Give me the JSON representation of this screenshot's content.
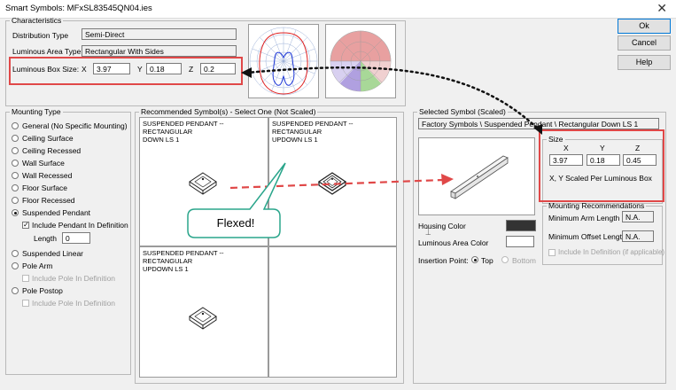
{
  "window": {
    "title": "Smart Symbols: MFxSL83545QN04.ies",
    "close_glyph": "✕"
  },
  "buttons": {
    "ok": "Ok",
    "cancel": "Cancel",
    "help": "Help"
  },
  "characteristics": {
    "legend": "Characteristics",
    "distribution_type_label": "Distribution Type",
    "distribution_type_value": "Semi-Direct",
    "luminous_area_type_label": "Luminous Area Type",
    "luminous_area_type_value": "Rectangular With Sides",
    "box_size_label": "Luminous Box Size:",
    "x_label": "X",
    "x_value": "3.97",
    "y_label": "Y",
    "y_value": "0.18",
    "z_label": "Z",
    "z_value": "0.2"
  },
  "mounting": {
    "legend": "Mounting Type",
    "options": [
      "General (No Specific Mounting)",
      "Ceiling Surface",
      "Ceiling Recessed",
      "Wall Surface",
      "Wall Recessed",
      "Floor Surface",
      "Floor Recessed",
      "Suspended Pendant"
    ],
    "include_pendant_label": "Include Pendant In Definition",
    "length_label": "Length",
    "length_value": "0",
    "suspended_linear_label": "Suspended Linear",
    "pole_arm_label": "Pole Arm",
    "include_pole_label_1": "Include Pole In Definition",
    "pole_postop_label": "Pole Postop",
    "include_pole_label_2": "Include Pole In Definition",
    "selected": "Suspended Pendant"
  },
  "recommended": {
    "legend": "Recommended Symbol(s) - Select One (Not Scaled)",
    "cells": [
      "SUSPENDED PENDANT -- RECTANGULAR\nDOWN LS 1",
      "SUSPENDED PENDANT -- RECTANGULAR\nUPDOWN LS 1",
      "SUSPENDED PENDANT -- RECTANGULAR\nUPDOWN LS 1"
    ]
  },
  "selected_symbol": {
    "legend": "Selected Symbol (Scaled)",
    "path": "Factory Symbols \\ Suspended Pendant \\ Rectangular Down LS 1",
    "size_legend": "Size",
    "x_label": "X",
    "y_label": "Y",
    "z_label": "Z",
    "x_value": "3.97",
    "y_value": "0.18",
    "z_value": "0.45",
    "scaled_note": "X, Y Scaled Per Luminous Box",
    "housing_color_label": "Housing Color",
    "housing_color": "#333333",
    "luminous_area_color_label": "Luminous Area Color",
    "luminous_area_color": "#ffffff",
    "insertion_point_label": "Insertion Point:",
    "top_label": "Top",
    "bottom_label": "Bottom",
    "insertion_selected": "Top"
  },
  "mounting_recommendations": {
    "legend": "Mounting Recommendations",
    "min_arm_label": "Minimum Arm Length",
    "min_arm_value": "N.A.",
    "min_offset_label": "Minimum Offset Length",
    "min_offset_value": "N.A.",
    "include_label": "Include In Definition (if applicable)"
  },
  "callout": {
    "text": "Flexed!"
  },
  "colors": {
    "annotation_red": "#e04848",
    "callout_green": "#2aa58b"
  }
}
